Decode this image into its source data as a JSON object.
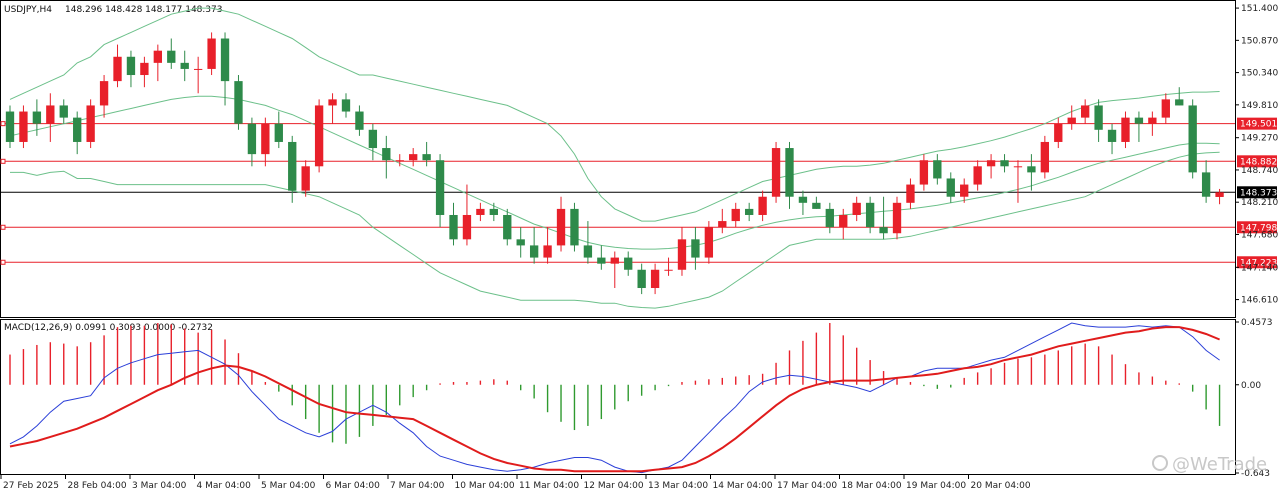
{
  "chart_data": {
    "type": "candlestick",
    "symbol_label": "USDJPY,H4",
    "ohlc_label": "148.296 148.428 148.177 148.373",
    "price_axis": {
      "range": [
        146.34,
        151.5
      ],
      "ticks": [
        "151.400",
        "150.870",
        "150.340",
        "149.810",
        "149.270",
        "148.740",
        "148.210",
        "147.680",
        "147.140",
        "146.610"
      ]
    },
    "current_price": {
      "label": "148.373",
      "value": 148.373
    },
    "levels": [
      {
        "label": "149.501",
        "value": 149.501
      },
      {
        "label": "148.882",
        "value": 148.882
      },
      {
        "label": "147.798",
        "value": 147.798
      },
      {
        "label": "147.223",
        "value": 147.223
      }
    ],
    "x_labels": [
      "27 Feb 2025",
      "28 Feb 04:00",
      "3 Mar 04:00",
      "4 Mar 04:00",
      "5 Mar 04:00",
      "6 Mar 04:00",
      "7 Mar 04:00",
      "10 Mar 04:00",
      "11 Mar 04:00",
      "12 Mar 04:00",
      "13 Mar 04:00",
      "14 Mar 04:00",
      "17 Mar 04:00",
      "18 Mar 04:00",
      "19 Mar 04:00",
      "20 Mar 04:00"
    ],
    "candles": [
      [
        149.7,
        149.8,
        149.1,
        149.2
      ],
      [
        149.2,
        149.8,
        149.1,
        149.7
      ],
      [
        149.7,
        149.9,
        149.3,
        149.5
      ],
      [
        149.5,
        150.0,
        149.2,
        149.8
      ],
      [
        149.8,
        149.9,
        149.5,
        149.6
      ],
      [
        149.6,
        149.7,
        149.0,
        149.2
      ],
      [
        149.2,
        149.9,
        149.1,
        149.8
      ],
      [
        149.8,
        150.3,
        149.6,
        150.2
      ],
      [
        150.2,
        150.8,
        150.1,
        150.6
      ],
      [
        150.6,
        150.7,
        150.1,
        150.3
      ],
      [
        150.3,
        150.6,
        150.1,
        150.5
      ],
      [
        150.5,
        150.8,
        150.2,
        150.7
      ],
      [
        150.7,
        150.9,
        150.4,
        150.5
      ],
      [
        150.5,
        150.7,
        150.2,
        150.4
      ],
      [
        150.4,
        150.6,
        150.0,
        150.4
      ],
      [
        150.4,
        151.0,
        150.3,
        150.9
      ],
      [
        150.9,
        151.0,
        149.8,
        150.2
      ],
      [
        150.2,
        150.3,
        149.4,
        149.5
      ],
      [
        149.5,
        149.6,
        148.8,
        149.0
      ],
      [
        149.0,
        149.6,
        148.8,
        149.5
      ],
      [
        149.5,
        149.7,
        149.1,
        149.2
      ],
      [
        149.2,
        149.3,
        148.2,
        148.4
      ],
      [
        148.4,
        148.9,
        148.3,
        148.8
      ],
      [
        148.8,
        149.9,
        148.7,
        149.8
      ],
      [
        149.8,
        150.0,
        149.5,
        149.9
      ],
      [
        149.9,
        150.0,
        149.6,
        149.7
      ],
      [
        149.7,
        149.8,
        149.3,
        149.4
      ],
      [
        149.4,
        149.5,
        148.9,
        149.1
      ],
      [
        149.1,
        149.3,
        148.6,
        148.9
      ],
      [
        148.9,
        149.0,
        148.8,
        148.9
      ],
      [
        148.9,
        149.1,
        148.8,
        149.0
      ],
      [
        149.0,
        149.2,
        148.8,
        148.9
      ],
      [
        148.9,
        149.0,
        147.8,
        148.0
      ],
      [
        148.0,
        148.2,
        147.5,
        147.6
      ],
      [
        147.6,
        148.5,
        147.5,
        148.0
      ],
      [
        148.0,
        148.2,
        147.9,
        148.1
      ],
      [
        148.1,
        148.2,
        147.9,
        148.0
      ],
      [
        148.0,
        148.1,
        147.5,
        147.6
      ],
      [
        147.6,
        147.8,
        147.3,
        147.5
      ],
      [
        147.5,
        147.8,
        147.2,
        147.3
      ],
      [
        147.3,
        147.8,
        147.2,
        147.5
      ],
      [
        147.5,
        148.3,
        147.4,
        148.1
      ],
      [
        148.1,
        148.2,
        147.4,
        147.5
      ],
      [
        147.5,
        147.9,
        147.2,
        147.3
      ],
      [
        147.3,
        147.5,
        147.1,
        147.2
      ],
      [
        147.2,
        147.4,
        146.8,
        147.3
      ],
      [
        147.3,
        147.4,
        147.0,
        147.1
      ],
      [
        147.1,
        147.2,
        146.7,
        146.8
      ],
      [
        146.8,
        147.2,
        146.7,
        147.1
      ],
      [
        147.1,
        147.3,
        147.0,
        147.1
      ],
      [
        147.1,
        147.8,
        147.0,
        147.6
      ],
      [
        147.6,
        147.8,
        147.1,
        147.3
      ],
      [
        147.3,
        147.9,
        147.2,
        147.8
      ],
      [
        147.8,
        148.1,
        147.7,
        147.9
      ],
      [
        147.9,
        148.2,
        147.8,
        148.1
      ],
      [
        148.1,
        148.2,
        147.9,
        148.0
      ],
      [
        148.0,
        148.4,
        147.9,
        148.3
      ],
      [
        148.3,
        149.2,
        148.2,
        149.1
      ],
      [
        149.1,
        149.2,
        148.1,
        148.3
      ],
      [
        148.3,
        148.4,
        148.0,
        148.2
      ],
      [
        148.2,
        148.3,
        148.1,
        148.1
      ],
      [
        148.1,
        148.2,
        147.7,
        147.8
      ],
      [
        147.8,
        148.1,
        147.6,
        148.0
      ],
      [
        148.0,
        148.3,
        147.9,
        148.2
      ],
      [
        148.2,
        148.3,
        147.7,
        147.8
      ],
      [
        147.8,
        148.3,
        147.6,
        147.7
      ],
      [
        147.7,
        148.3,
        147.6,
        148.2
      ],
      [
        148.2,
        148.6,
        148.1,
        148.5
      ],
      [
        148.5,
        149.0,
        148.4,
        148.9
      ],
      [
        148.9,
        149.0,
        148.5,
        148.6
      ],
      [
        148.6,
        148.7,
        148.2,
        148.3
      ],
      [
        148.3,
        148.6,
        148.2,
        148.5
      ],
      [
        148.5,
        148.9,
        148.4,
        148.8
      ],
      [
        148.8,
        149.0,
        148.6,
        148.9
      ],
      [
        148.9,
        149.0,
        148.7,
        148.8
      ],
      [
        148.8,
        148.9,
        148.2,
        148.8
      ],
      [
        148.8,
        149.0,
        148.4,
        148.7
      ],
      [
        148.7,
        149.3,
        148.6,
        149.2
      ],
      [
        149.2,
        149.6,
        149.1,
        149.5
      ],
      [
        149.5,
        149.8,
        149.4,
        149.6
      ],
      [
        149.6,
        149.9,
        149.5,
        149.8
      ],
      [
        149.8,
        149.9,
        149.2,
        149.4
      ],
      [
        149.4,
        149.5,
        149.0,
        149.2
      ],
      [
        149.2,
        149.7,
        149.1,
        149.6
      ],
      [
        149.6,
        149.7,
        149.2,
        149.5
      ],
      [
        149.5,
        149.7,
        149.3,
        149.6
      ],
      [
        149.6,
        150.0,
        149.5,
        149.9
      ],
      [
        149.9,
        150.1,
        149.8,
        149.8
      ],
      [
        149.8,
        149.9,
        148.6,
        148.7
      ],
      [
        148.7,
        148.9,
        148.2,
        148.3
      ],
      [
        148.296,
        148.428,
        148.177,
        148.373
      ]
    ],
    "bands": {
      "upper": [
        149.9,
        150.0,
        150.1,
        150.2,
        150.3,
        150.5,
        150.6,
        150.8,
        150.9,
        151.0,
        151.1,
        151.2,
        151.3,
        151.35,
        151.4,
        151.4,
        151.35,
        151.3,
        151.2,
        151.1,
        151.0,
        150.9,
        150.75,
        150.6,
        150.5,
        150.4,
        150.3,
        150.3,
        150.25,
        150.2,
        150.15,
        150.1,
        150.05,
        150.0,
        149.95,
        149.9,
        149.85,
        149.8,
        149.7,
        149.6,
        149.5,
        149.3,
        149.0,
        148.6,
        148.3,
        148.1,
        148.0,
        147.9,
        147.9,
        147.95,
        148.0,
        148.05,
        148.15,
        148.25,
        148.35,
        148.45,
        148.55,
        148.6,
        148.65,
        148.7,
        148.75,
        148.78,
        148.8,
        148.8,
        148.82,
        148.85,
        148.9,
        148.95,
        149.0,
        149.05,
        149.08,
        149.12,
        149.17,
        149.22,
        149.28,
        149.35,
        149.42,
        149.5,
        149.6,
        149.7,
        149.78,
        149.85,
        149.88,
        149.9,
        149.92,
        149.95,
        149.98,
        150.0,
        150.02,
        150.02,
        150.03
      ],
      "middle": [
        149.3,
        149.35,
        149.4,
        149.45,
        149.5,
        149.55,
        149.6,
        149.65,
        149.7,
        149.75,
        149.8,
        149.85,
        149.9,
        149.93,
        149.95,
        149.95,
        149.93,
        149.9,
        149.85,
        149.8,
        149.72,
        149.65,
        149.55,
        149.45,
        149.35,
        149.25,
        149.15,
        149.05,
        148.95,
        148.85,
        148.75,
        148.65,
        148.55,
        148.45,
        148.35,
        148.25,
        148.15,
        148.05,
        147.95,
        147.85,
        147.78,
        147.7,
        147.62,
        147.55,
        147.5,
        147.47,
        147.45,
        147.44,
        147.44,
        147.45,
        147.47,
        147.5,
        147.55,
        147.62,
        147.7,
        147.77,
        147.83,
        147.88,
        147.92,
        147.95,
        147.97,
        147.98,
        148.0,
        148.02,
        148.04,
        148.06,
        148.08,
        148.1,
        148.13,
        148.16,
        148.2,
        148.24,
        148.28,
        148.32,
        148.37,
        148.42,
        148.48,
        148.55,
        148.62,
        148.7,
        148.78,
        148.85,
        148.9,
        148.95,
        149.0,
        149.05,
        149.1,
        149.15,
        149.18,
        149.18,
        149.17
      ],
      "lower": [
        148.7,
        148.7,
        148.65,
        148.7,
        148.72,
        148.6,
        148.6,
        148.55,
        148.5,
        148.5,
        148.5,
        148.5,
        148.5,
        148.5,
        148.5,
        148.5,
        148.5,
        148.5,
        148.5,
        148.5,
        148.45,
        148.4,
        148.35,
        148.3,
        148.2,
        148.1,
        148.0,
        147.8,
        147.65,
        147.5,
        147.35,
        147.2,
        147.05,
        146.95,
        146.85,
        146.75,
        146.7,
        146.65,
        146.6,
        146.6,
        146.6,
        146.6,
        146.6,
        146.58,
        146.55,
        146.55,
        146.5,
        146.48,
        146.47,
        146.5,
        146.55,
        146.6,
        146.65,
        146.75,
        146.9,
        147.05,
        147.2,
        147.35,
        147.5,
        147.55,
        147.6,
        147.6,
        147.6,
        147.6,
        147.6,
        147.6,
        147.62,
        147.65,
        147.7,
        147.75,
        147.8,
        147.85,
        147.9,
        147.95,
        148.0,
        148.05,
        148.1,
        148.15,
        148.2,
        148.25,
        148.3,
        148.4,
        148.5,
        148.6,
        148.7,
        148.8,
        148.88,
        148.95,
        149.0,
        149.02,
        149.03
      ]
    },
    "macd": {
      "label": "MACD(12,26,9) 0.0991 0.3093 0.0000 -0.2732",
      "range": [
        -0.643,
        0.4573
      ],
      "ticks": [
        "0.4573",
        "0.00",
        "-0.643"
      ],
      "histogram": [
        0.22,
        0.26,
        0.29,
        0.31,
        0.3,
        0.28,
        0.31,
        0.36,
        0.42,
        0.43,
        0.43,
        0.45,
        0.44,
        0.41,
        0.38,
        0.4,
        0.33,
        0.23,
        0.1,
        0.02,
        -0.05,
        -0.15,
        -0.25,
        -0.35,
        -0.42,
        -0.43,
        -0.38,
        -0.3,
        -0.22,
        -0.15,
        -0.09,
        -0.04,
        0.01,
        0.02,
        0.02,
        0.03,
        0.04,
        0.03,
        -0.04,
        -0.1,
        -0.2,
        -0.27,
        -0.33,
        -0.3,
        -0.25,
        -0.18,
        -0.12,
        -0.08,
        -0.04,
        -0.01,
        0.02,
        0.03,
        0.04,
        0.05,
        0.06,
        0.07,
        0.08,
        0.16,
        0.25,
        0.32,
        0.38,
        0.45,
        0.36,
        0.27,
        0.18,
        0.1,
        0.05,
        0.02,
        -0.01,
        -0.03,
        -0.02,
        0.05,
        0.09,
        0.12,
        0.16,
        0.19,
        0.2,
        0.22,
        0.25,
        0.28,
        0.3,
        0.28,
        0.22,
        0.15,
        0.09,
        0.06,
        0.03,
        0.01,
        -0.05,
        -0.18,
        -0.3
      ],
      "macd_line": [
        -0.43,
        -0.38,
        -0.3,
        -0.2,
        -0.12,
        -0.1,
        -0.08,
        0.05,
        0.12,
        0.16,
        0.19,
        0.22,
        0.23,
        0.24,
        0.25,
        0.2,
        0.15,
        0.07,
        -0.05,
        -0.15,
        -0.25,
        -0.3,
        -0.35,
        -0.38,
        -0.34,
        -0.25,
        -0.2,
        -0.15,
        -0.2,
        -0.28,
        -0.35,
        -0.45,
        -0.52,
        -0.55,
        -0.58,
        -0.6,
        -0.62,
        -0.63,
        -0.62,
        -0.6,
        -0.57,
        -0.55,
        -0.53,
        -0.53,
        -0.55,
        -0.6,
        -0.63,
        -0.64,
        -0.62,
        -0.6,
        -0.55,
        -0.45,
        -0.35,
        -0.25,
        -0.16,
        -0.05,
        0.02,
        0.05,
        0.07,
        0.06,
        0.04,
        0.02,
        0.0,
        -0.02,
        -0.05,
        0.0,
        0.05,
        0.06,
        0.1,
        0.12,
        0.12,
        0.12,
        0.15,
        0.18,
        0.2,
        0.25,
        0.3,
        0.35,
        0.4,
        0.45,
        0.43,
        0.42,
        0.42,
        0.42,
        0.43,
        0.42,
        0.43,
        0.42,
        0.35,
        0.25,
        0.18
      ],
      "signal_line": [
        -0.45,
        -0.43,
        -0.41,
        -0.38,
        -0.35,
        -0.32,
        -0.28,
        -0.24,
        -0.19,
        -0.14,
        -0.09,
        -0.04,
        0.0,
        0.05,
        0.09,
        0.12,
        0.14,
        0.13,
        0.1,
        0.06,
        0.01,
        -0.04,
        -0.09,
        -0.14,
        -0.17,
        -0.2,
        -0.21,
        -0.22,
        -0.23,
        -0.24,
        -0.25,
        -0.3,
        -0.35,
        -0.4,
        -0.45,
        -0.5,
        -0.54,
        -0.57,
        -0.59,
        -0.61,
        -0.62,
        -0.62,
        -0.63,
        -0.63,
        -0.63,
        -0.63,
        -0.63,
        -0.63,
        -0.62,
        -0.61,
        -0.6,
        -0.57,
        -0.52,
        -0.46,
        -0.39,
        -0.31,
        -0.23,
        -0.15,
        -0.08,
        -0.03,
        0.0,
        0.02,
        0.03,
        0.03,
        0.03,
        0.04,
        0.05,
        0.06,
        0.07,
        0.08,
        0.1,
        0.12,
        0.13,
        0.15,
        0.18,
        0.2,
        0.22,
        0.25,
        0.28,
        0.3,
        0.32,
        0.34,
        0.36,
        0.38,
        0.39,
        0.41,
        0.42,
        0.42,
        0.4,
        0.37,
        0.33
      ]
    },
    "colors": {
      "bull": "#e8202a",
      "bear": "#2e8a4a",
      "band": "#6cc08a",
      "level": "#e8202a",
      "macd_line": "#2b3fd8",
      "signal_line": "#e01c1c",
      "hist_pos": "#e8202a",
      "hist_neg": "#2f9a2f"
    }
  },
  "watermark": "@WeTrade"
}
